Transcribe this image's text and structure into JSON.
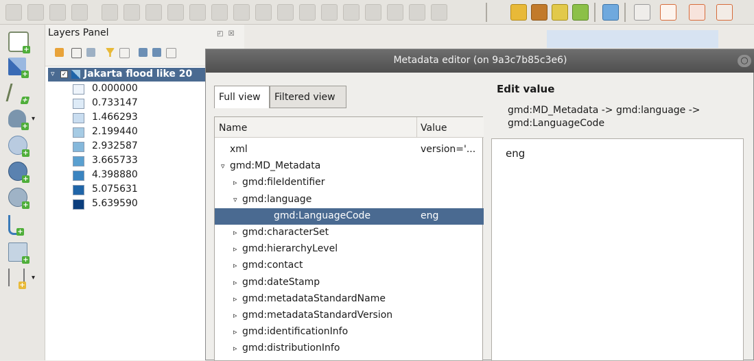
{
  "layers_panel": {
    "title": "Layers Panel",
    "layer_name": "Jakarta flood like 20",
    "legend": [
      {
        "label": "0.000000",
        "color": "#eef4fb"
      },
      {
        "label": "0.733147",
        "color": "#deebf7"
      },
      {
        "label": "1.466293",
        "color": "#c9ddf0"
      },
      {
        "label": "2.199440",
        "color": "#a6cbe4"
      },
      {
        "label": "2.932587",
        "color": "#85b8db"
      },
      {
        "label": "3.665733",
        "color": "#5aa0d0"
      },
      {
        "label": "4.398880",
        "color": "#3a84c0"
      },
      {
        "label": "5.075631",
        "color": "#1f65a8"
      },
      {
        "label": "5.639590",
        "color": "#0b3e7d"
      }
    ]
  },
  "editor": {
    "title": "Metadata editor (on 9a3c7b85c3e6)",
    "tabs": [
      "Full view",
      "Filtered view"
    ],
    "columns": {
      "name": "Name",
      "value": "Value"
    },
    "tree": [
      {
        "name": "xml",
        "value": "version='...",
        "indent": 0,
        "toggle": ""
      },
      {
        "name": "gmd:MD_Metadata",
        "value": "",
        "indent": 0,
        "toggle": "▿"
      },
      {
        "name": "gmd:fileIdentifier",
        "value": "",
        "indent": 1,
        "toggle": "▹"
      },
      {
        "name": "gmd:language",
        "value": "",
        "indent": 1,
        "toggle": "▿"
      },
      {
        "name": "gmd:LanguageCode",
        "value": "eng",
        "indent": 2,
        "toggle": "",
        "selected": true
      },
      {
        "name": "gmd:characterSet",
        "value": "",
        "indent": 1,
        "toggle": "▹"
      },
      {
        "name": "gmd:hierarchyLevel",
        "value": "",
        "indent": 1,
        "toggle": "▹"
      },
      {
        "name": "gmd:contact",
        "value": "",
        "indent": 1,
        "toggle": "▹"
      },
      {
        "name": "gmd:dateStamp",
        "value": "",
        "indent": 1,
        "toggle": "▹"
      },
      {
        "name": "gmd:metadataStandardName",
        "value": "",
        "indent": 1,
        "toggle": "▹"
      },
      {
        "name": "gmd:metadataStandardVersion",
        "value": "",
        "indent": 1,
        "toggle": "▹"
      },
      {
        "name": "gmd:identificationInfo",
        "value": "",
        "indent": 1,
        "toggle": "▹"
      },
      {
        "name": "gmd:distributionInfo",
        "value": "",
        "indent": 1,
        "toggle": "▹"
      }
    ],
    "edit": {
      "title": "Edit value",
      "path": "gmd:MD_Metadata -> gmd:language -> gmd:LanguageCode",
      "value": "eng"
    }
  },
  "colors": {
    "selection": "#4a6a91",
    "titlebar": "#5a5a5a",
    "add_badge": "#4fae3a"
  }
}
